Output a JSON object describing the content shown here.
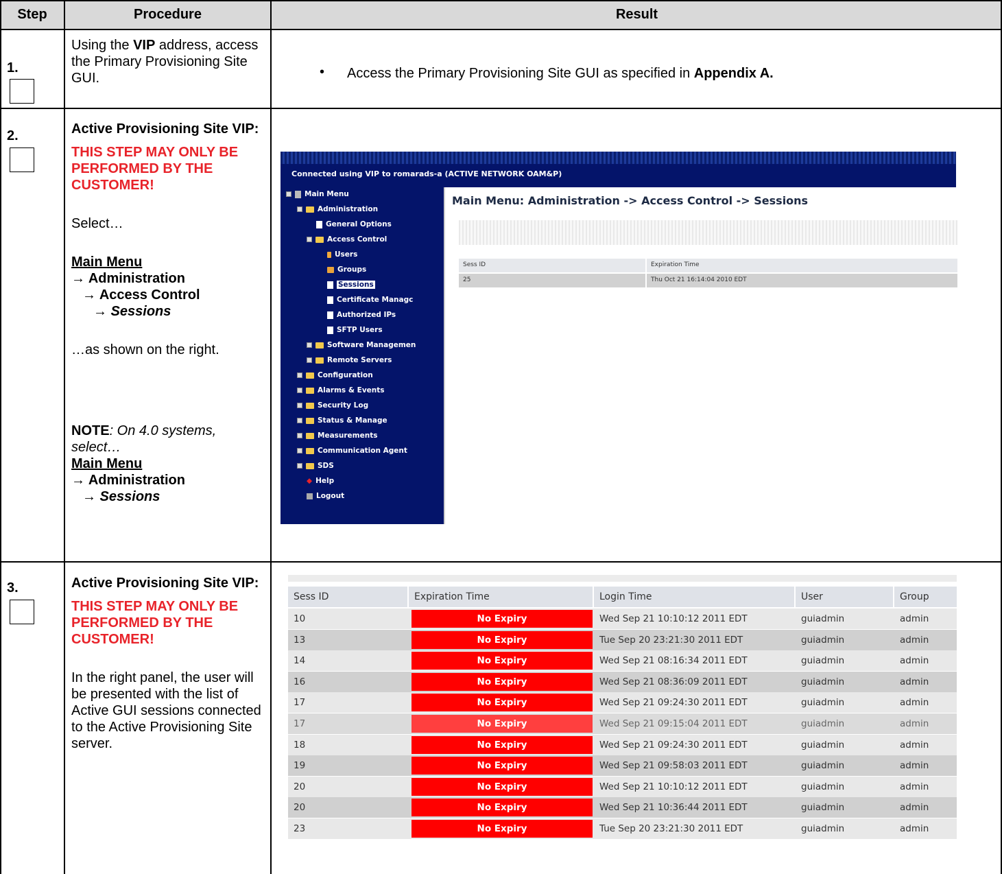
{
  "header": {
    "step": "Step",
    "procedure": "Procedure",
    "result": "Result"
  },
  "steps": [
    {
      "number": "1.",
      "procedure": {
        "p1_pre": "Using the ",
        "p1_bold": "VIP",
        "p1_post": " address, access the Primary Provisioning Site GUI."
      },
      "result": {
        "bullet_text": "Access the Primary Provisioning Site GUI as specified in ",
        "bullet_bold": "Appendix A."
      }
    },
    {
      "number": "2.",
      "procedure": {
        "heading": "Active Provisioning Site VIP:",
        "warning": "THIS STEP MAY ONLY BE PERFORMED BY THE CUSTOMER!",
        "select": "Select…",
        "menu_main": "Main Menu",
        "menu_admin": "→ Administration",
        "menu_access": "→ Access Control",
        "menu_sessions": "→ Sessions",
        "as_shown": "…as shown on the right.",
        "note_label": "NOTE",
        "note_text": ": On 4.0 systems, select…",
        "note_main": "Main Menu",
        "note_admin": "→ Administration",
        "note_sessions": "→ Sessions"
      },
      "screenshot": {
        "banner": "Connected using VIP to romarads-a (ACTIVE NETWORK OAM&P)",
        "title": "Main Menu: Administration -> Access Control -> Sessions",
        "menu": [
          "Main Menu",
          "Administration",
          "General Options",
          "Access Control",
          "Users",
          "Groups",
          "Sessions",
          "Certificate Managc",
          "Authorized IPs",
          "SFTP Users",
          "Software Managemen",
          "Remote Servers",
          "Configuration",
          "Alarms & Events",
          "Security Log",
          "Status & Manage",
          "Measurements",
          "Communication Agent",
          "SDS",
          "Help",
          "Logout"
        ],
        "table_headers": [
          "Sess ID",
          "Expiration Time"
        ],
        "table_row": [
          "25",
          "Thu Oct 21 16:14:04 2010 EDT"
        ]
      }
    },
    {
      "number": "3.",
      "procedure": {
        "heading": "Active Provisioning Site VIP:",
        "warning": "THIS STEP MAY ONLY BE PERFORMED BY THE CUSTOMER!",
        "body": "In the right panel, the user will be presented with the list of Active GUI sessions connected to the Active Provisioning Site server."
      },
      "screenshot": {
        "headers": [
          "Sess ID",
          "Expiration Time",
          "Login Time",
          "User",
          "Group"
        ],
        "rows": [
          {
            "id": "10",
            "exp": "No Expiry",
            "login": "Wed Sep 21 10:10:12 2011 EDT",
            "user": "guiadmin",
            "group": "admin"
          },
          {
            "id": "13",
            "exp": "No Expiry",
            "login": "Tue Sep 20 23:21:30 2011 EDT",
            "user": "guiadmin",
            "group": "admin"
          },
          {
            "id": "14",
            "exp": "No Expiry",
            "login": "Wed Sep 21 08:16:34 2011 EDT",
            "user": "guiadmin",
            "group": "admin"
          },
          {
            "id": "16",
            "exp": "No Expiry",
            "login": "Wed Sep 21 08:36:09 2011 EDT",
            "user": "guiadmin",
            "group": "admin"
          },
          {
            "id": "17",
            "exp": "No Expiry",
            "login": "Wed Sep 21 09:24:30 2011 EDT",
            "user": "guiadmin",
            "group": "admin"
          },
          {
            "id": "17",
            "exp": "No Expiry",
            "login": "Wed Sep 21 09:15:04 2011 EDT",
            "user": "guiadmin",
            "group": "admin"
          },
          {
            "id": "18",
            "exp": "No Expiry",
            "login": "Wed Sep 21 09:24:30 2011 EDT",
            "user": "guiadmin",
            "group": "admin"
          },
          {
            "id": "19",
            "exp": "No Expiry",
            "login": "Wed Sep 21 09:58:03 2011 EDT",
            "user": "guiadmin",
            "group": "admin"
          },
          {
            "id": "20",
            "exp": "No Expiry",
            "login": "Wed Sep 21 10:10:12 2011 EDT",
            "user": "guiadmin",
            "group": "admin"
          },
          {
            "id": "20",
            "exp": "No Expiry",
            "login": "Wed Sep 21 10:36:44 2011 EDT",
            "user": "guiadmin",
            "group": "admin"
          },
          {
            "id": "23",
            "exp": "No Expiry",
            "login": "Tue Sep 20 23:21:30 2011 EDT",
            "user": "guiadmin",
            "group": "admin"
          }
        ]
      }
    }
  ]
}
